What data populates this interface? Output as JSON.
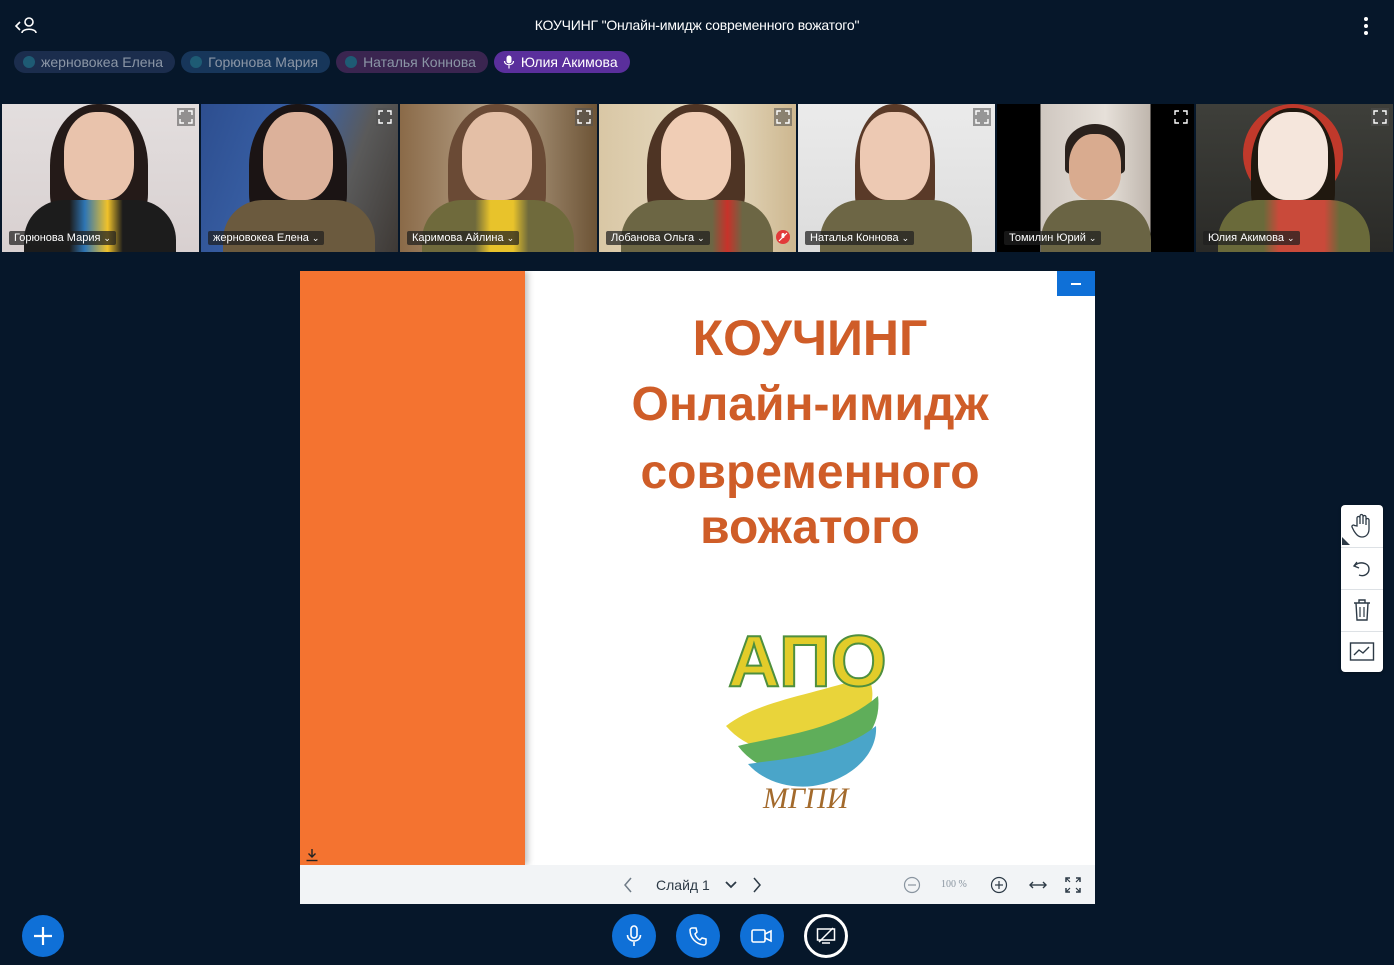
{
  "meeting": {
    "title": "КОУЧИНГ \"Онлайн-имидж современного вожатого\""
  },
  "talkers": [
    {
      "label": "жерновокеа Елена",
      "active": false
    },
    {
      "label": "Горюнова Мария",
      "active": false
    },
    {
      "label": "Наталья Коннова",
      "active": false
    },
    {
      "label": "Юлия Акимова",
      "active": true
    }
  ],
  "videos": [
    {
      "name": "Горюнова Мария"
    },
    {
      "name": "жерновокеа Елена"
    },
    {
      "name": "Каримова Айлина"
    },
    {
      "name": "Лобанова Ольга"
    },
    {
      "name": "Наталья Коннова"
    },
    {
      "name": "Томилин Юрий"
    },
    {
      "name": "Юлия Акимова"
    }
  ],
  "slide": {
    "line1": "КОУЧИНГ",
    "line2": "Онлайн-имидж",
    "line3": "современного вожатого",
    "logo_text": "АПО",
    "logo_subtext": "МГПИ"
  },
  "presentation_toolbar": {
    "slide_label": "Слайд 1",
    "zoom": "100 %"
  },
  "colors": {
    "background": "#06172a",
    "accent": "#0f70d7",
    "slide_stripe": "#f47330",
    "slide_title": "#cf5d28"
  },
  "icons": {
    "whiteboard": [
      "hand-icon",
      "undo-icon",
      "trash-icon",
      "multiuser-icon"
    ],
    "controls": [
      "microphone-icon",
      "phone-icon",
      "camera-icon",
      "screen-share-icon"
    ]
  }
}
